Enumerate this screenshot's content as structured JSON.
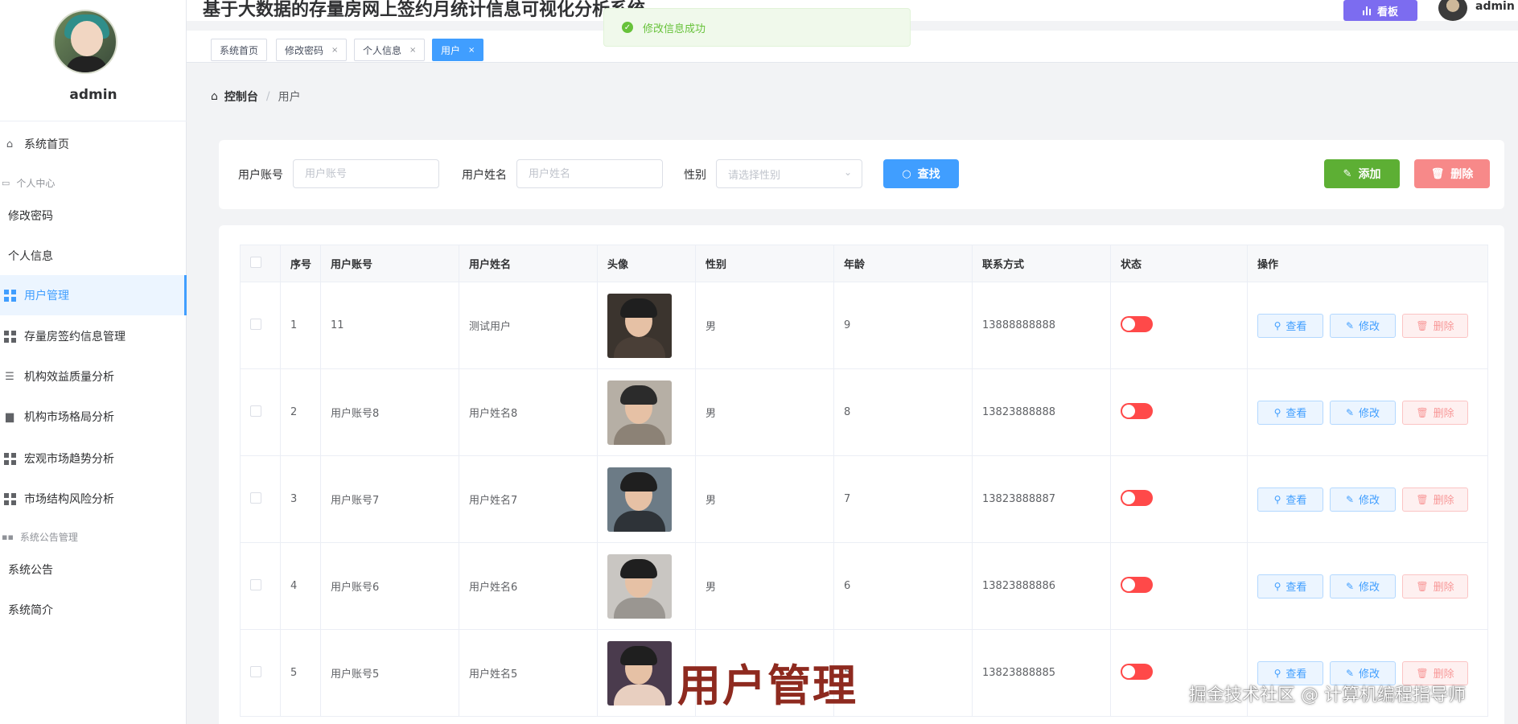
{
  "app": {
    "title": "基于大数据的存量房网上签约月统计信息可视化分析系统"
  },
  "header": {
    "kanban_label": "看板",
    "user_name": "admin"
  },
  "sidebar": {
    "user_name": "admin",
    "items": [
      {
        "label": "系统首页",
        "icon": "home-icon"
      },
      {
        "label": "个人中心",
        "icon": "id-card-icon",
        "group": true
      },
      {
        "label": "修改密码"
      },
      {
        "label": "个人信息"
      },
      {
        "label": "用户管理",
        "icon": "grid-icon",
        "active": true
      },
      {
        "label": "存量房签约信息管理",
        "icon": "grid-icon"
      },
      {
        "label": "机构效益质量分析",
        "icon": "sliders-icon"
      },
      {
        "label": "机构市场格局分析",
        "icon": "briefcase-icon"
      },
      {
        "label": "宏观市场趋势分析",
        "icon": "grid-icon"
      },
      {
        "label": "市场结构风险分析",
        "icon": "grid-icon"
      },
      {
        "label": "系统公告管理",
        "icon": "grid-icon",
        "group": true
      },
      {
        "label": "系统公告"
      },
      {
        "label": "系统简介"
      }
    ]
  },
  "tabs": [
    {
      "label": "系统首页",
      "closable": false
    },
    {
      "label": "修改密码",
      "closable": true
    },
    {
      "label": "个人信息",
      "closable": true
    },
    {
      "label": "用户",
      "closable": true,
      "active": true
    }
  ],
  "toast": {
    "message": "修改信息成功",
    "color": "#67c23a"
  },
  "breadcrumb": {
    "root": "控制台",
    "current": "用户"
  },
  "search": {
    "account_label": "用户账号",
    "account_placeholder": "用户账号",
    "name_label": "用户姓名",
    "name_placeholder": "用户姓名",
    "gender_label": "性别",
    "gender_placeholder": "请选择性别",
    "find_button": "查找",
    "add_button": "添加",
    "delete_button": "删除"
  },
  "table": {
    "columns": [
      "序号",
      "用户账号",
      "用户姓名",
      "头像",
      "性别",
      "年龄",
      "联系方式",
      "状态",
      "操作"
    ],
    "actions": {
      "view": "查看",
      "edit": "修改",
      "delete": "删除"
    },
    "rows": [
      {
        "index": "1",
        "account": "11",
        "name": "测试用户",
        "gender": "男",
        "age": "9",
        "phone": "13888888888",
        "enabled": false
      },
      {
        "index": "2",
        "account": "用户账号8",
        "name": "用户姓名8",
        "gender": "男",
        "age": "8",
        "phone": "13823888888",
        "enabled": false
      },
      {
        "index": "3",
        "account": "用户账号7",
        "name": "用户姓名7",
        "gender": "男",
        "age": "7",
        "phone": "13823888887",
        "enabled": false
      },
      {
        "index": "4",
        "account": "用户账号6",
        "name": "用户姓名6",
        "gender": "男",
        "age": "6",
        "phone": "13823888886",
        "enabled": false
      },
      {
        "index": "5",
        "account": "用户账号5",
        "name": "用户姓名5",
        "gender": "",
        "age": "5",
        "phone": "13823888885",
        "enabled": false
      }
    ]
  },
  "overlay": {
    "caption": "用户管理",
    "watermark": "掘金技术社区 @ 计算机编程指导师"
  },
  "colors": {
    "primary": "#409eff",
    "success": "#67c23a",
    "danger": "#f56c6c",
    "kanban": "#7c6cf0"
  }
}
